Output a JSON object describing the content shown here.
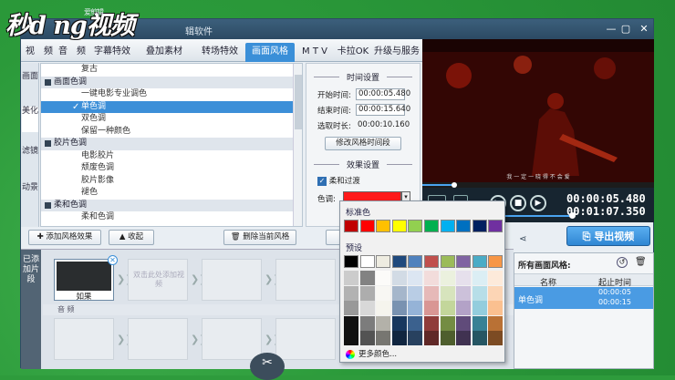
{
  "logo": {
    "text": "秒d ng视频",
    "sup": "爱剪辑"
  },
  "window": {
    "title": "辑软件",
    "min": "—",
    "max": "▢",
    "close": "✕"
  },
  "tabs": [
    "视　频",
    "音　频",
    "字幕特效",
    "叠加素材",
    "转场特效",
    "画面风格",
    "M T V",
    "卡拉OK",
    "升级与服务"
  ],
  "active_tab": "画面风格",
  "side_tabs": [
    "画面",
    "美化",
    "滤镜",
    "动景"
  ],
  "style_list": [
    {
      "label": "复古",
      "type": "item"
    },
    {
      "label": "画面色调",
      "type": "cat"
    },
    {
      "label": "一键电影专业调色",
      "type": "item"
    },
    {
      "label": "单色调",
      "type": "sel"
    },
    {
      "label": "双色调",
      "type": "item"
    },
    {
      "label": "保留一种颜色",
      "type": "item"
    },
    {
      "label": "胶片色调",
      "type": "cat"
    },
    {
      "label": "电影胶片",
      "type": "item"
    },
    {
      "label": "颓废色调",
      "type": "item"
    },
    {
      "label": "胶片影像",
      "type": "item"
    },
    {
      "label": "褪色",
      "type": "item"
    },
    {
      "label": "柔和色调",
      "type": "cat"
    },
    {
      "label": "柔和色调",
      "type": "item"
    }
  ],
  "settings": {
    "time_section": "时间设置",
    "start_label": "开始时间:",
    "start_value": "00:00:05.480",
    "end_label": "结束时间:",
    "end_value": "00:00:15.640",
    "dur_label": "选取时长:",
    "dur_value": "00:00:10.160",
    "modify_btn": "修改风格时间段",
    "effect_section": "效果设置",
    "soft_label": "柔和过渡",
    "hue_label": "色调:",
    "hue_color": "#ff1a1a"
  },
  "buttons": {
    "add": "添加风格效果",
    "collapse": "收起",
    "delete": "删除当前风格",
    "export": "导出视频"
  },
  "preview": {
    "subtitle": "我 一 定 一 晓 得 不 会 爱",
    "time_cur": "00:00:05.480",
    "time_total": "00:01:07.350"
  },
  "color_popup": {
    "std_label": "标准色",
    "std_colors": [
      "#c00000",
      "#ff0000",
      "#ffc000",
      "#ffff00",
      "#92d050",
      "#00b050",
      "#00b0f0",
      "#0070c0",
      "#002060",
      "#7030a0"
    ],
    "preset_label": "预设",
    "theme_top": [
      "#000000",
      "#ffffff",
      "#eeece1",
      "#1f497d",
      "#4f81bd",
      "#c0504d",
      "#9bbb59",
      "#8064a2",
      "#4bacc6",
      "#f79646"
    ],
    "more": "更多颜色..."
  },
  "timeline": {
    "side_label": "已添加片段",
    "clip_label": "如果",
    "hint": "双击此处添加视频",
    "audio_label": "音 频"
  },
  "style_table": {
    "title": "所有画面风格:",
    "col_name": "名称",
    "col_time": "起止时间",
    "row_name": "单色调",
    "row_start": "00:00:05",
    "row_end": "00:00:15"
  }
}
